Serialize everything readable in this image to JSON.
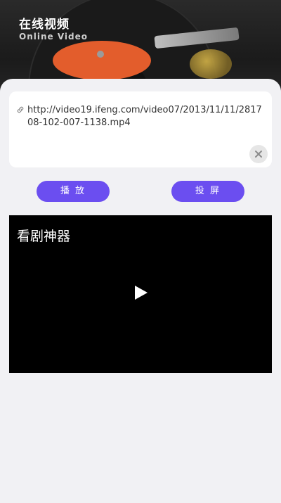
{
  "header": {
    "title": "在线视频",
    "subtitle": "Online Video"
  },
  "url_input": {
    "value": "http://video19.ifeng.com/video07/2013/11/11/281708-102-007-1138.mp4",
    "icons": {
      "link": "link-icon",
      "clear": "close-circle-icon"
    }
  },
  "actions": {
    "play_label": "播 放",
    "cast_label": "投 屏",
    "accent_color": "#6b4ef0"
  },
  "player": {
    "title": "看剧神器",
    "icon": "play-icon"
  }
}
